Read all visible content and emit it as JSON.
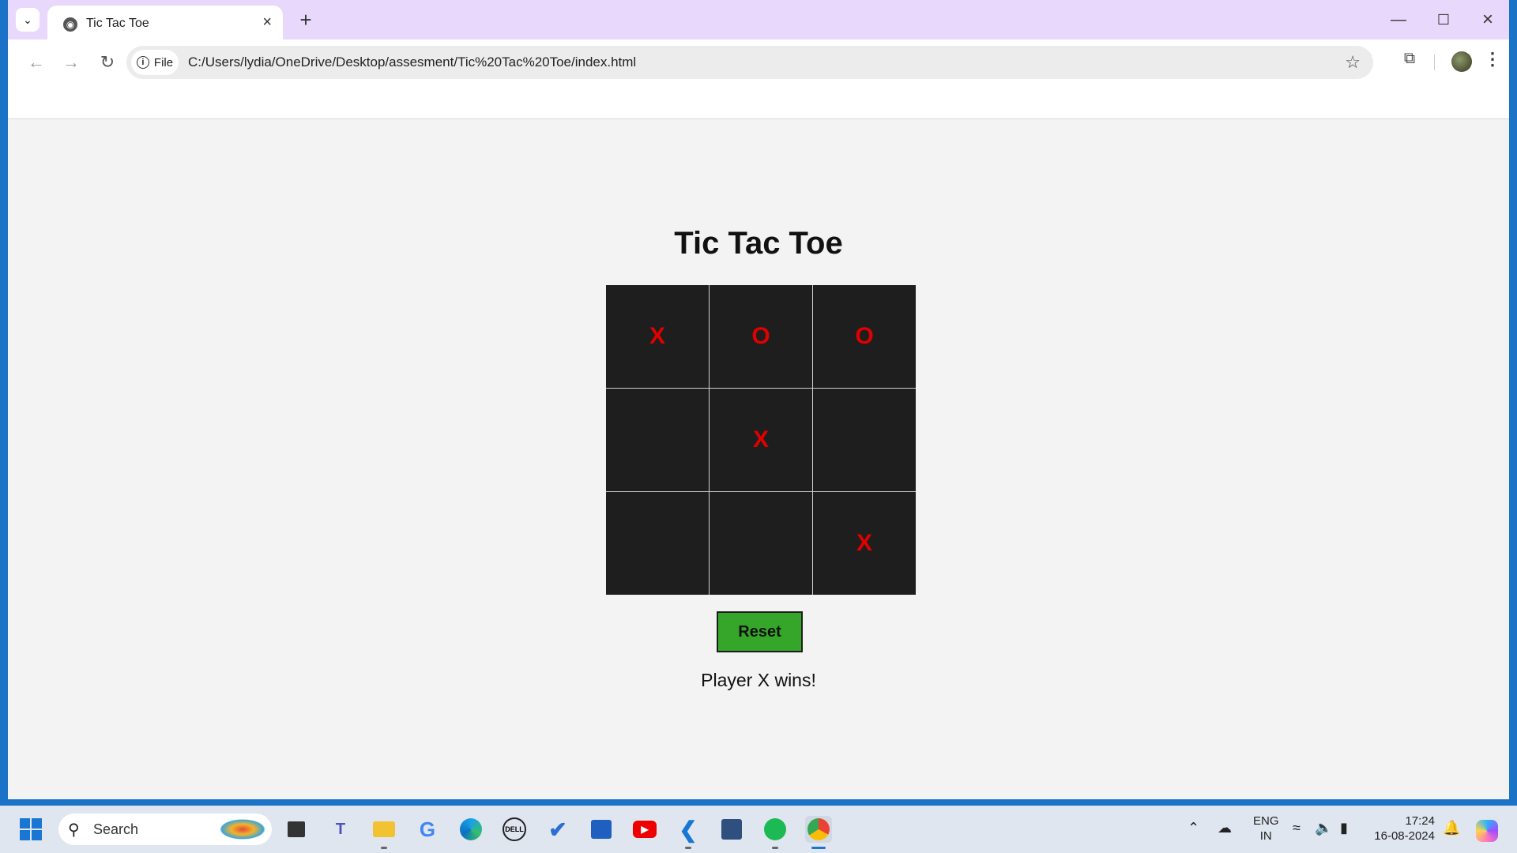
{
  "browser": {
    "tab_title": "Tic Tac Toe",
    "new_tab_label": "+",
    "address_chip": "File",
    "url": "C:/Users/lydia/OneDrive/Desktop/assesment/Tic%20Tac%20Toe/index.html"
  },
  "game": {
    "title": "Tic Tac Toe",
    "cells": [
      "X",
      "O",
      "O",
      "",
      "X",
      "",
      "",
      "",
      "X"
    ],
    "mark_color": "#e00000",
    "reset_label": "Reset",
    "status": "Player X wins!"
  },
  "taskbar": {
    "search_label": "Search",
    "lang_top": "ENG",
    "lang_bottom": "IN",
    "time": "17:24",
    "date": "16-08-2024"
  },
  "icons": {
    "tab_search": "chevron-down-icon",
    "favicon": "globe-icon",
    "tab_close": "close-icon",
    "back": "arrow-left-icon",
    "forward": "arrow-right-icon",
    "reload": "reload-icon",
    "bookmark": "star-icon",
    "extensions": "puzzle-icon",
    "menu": "kebab-menu-icon"
  },
  "colors": {
    "tabstrip": "#e8d8fb",
    "page_bg": "#f3f3f3",
    "cell_bg": "#1e1e1e",
    "reset_bg": "#35a62a"
  }
}
